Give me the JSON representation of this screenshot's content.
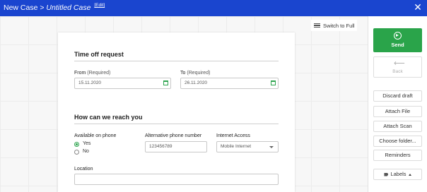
{
  "topbar": {
    "crumb": "New Case >",
    "title": "Untitled Case",
    "edit": "[Edit]",
    "close_icon": "close-icon"
  },
  "toolbar": {
    "switch_label": "Switch to Full",
    "switch_icon": "list-icon"
  },
  "form": {
    "section1": "Time off request",
    "from_label": "From",
    "from_req": "(Required)",
    "from_value": "15.11.2020",
    "to_label": "To",
    "to_req": "(Required)",
    "to_value": "26.11.2020",
    "section2": "How can we reach you",
    "phone_label": "Available on phone",
    "phone_options": [
      "Yes",
      "No"
    ],
    "phone_selected": "Yes",
    "alt_phone_label": "Alternative phone number",
    "alt_phone_value": "123456789",
    "internet_label": "Internet Access",
    "internet_value": "Mobile Internet",
    "location_label": "Location",
    "location_value": ""
  },
  "side": {
    "send": "Send",
    "back": "Back",
    "discard": "Discard draft",
    "attach_file": "Attach File",
    "attach_scan": "Attach Scan",
    "choose_folder": "Choose folder...",
    "reminders": "Reminders",
    "labels": "Labels"
  },
  "colors": {
    "topbar": "#1a45cf",
    "accent": "#2aa44a"
  }
}
